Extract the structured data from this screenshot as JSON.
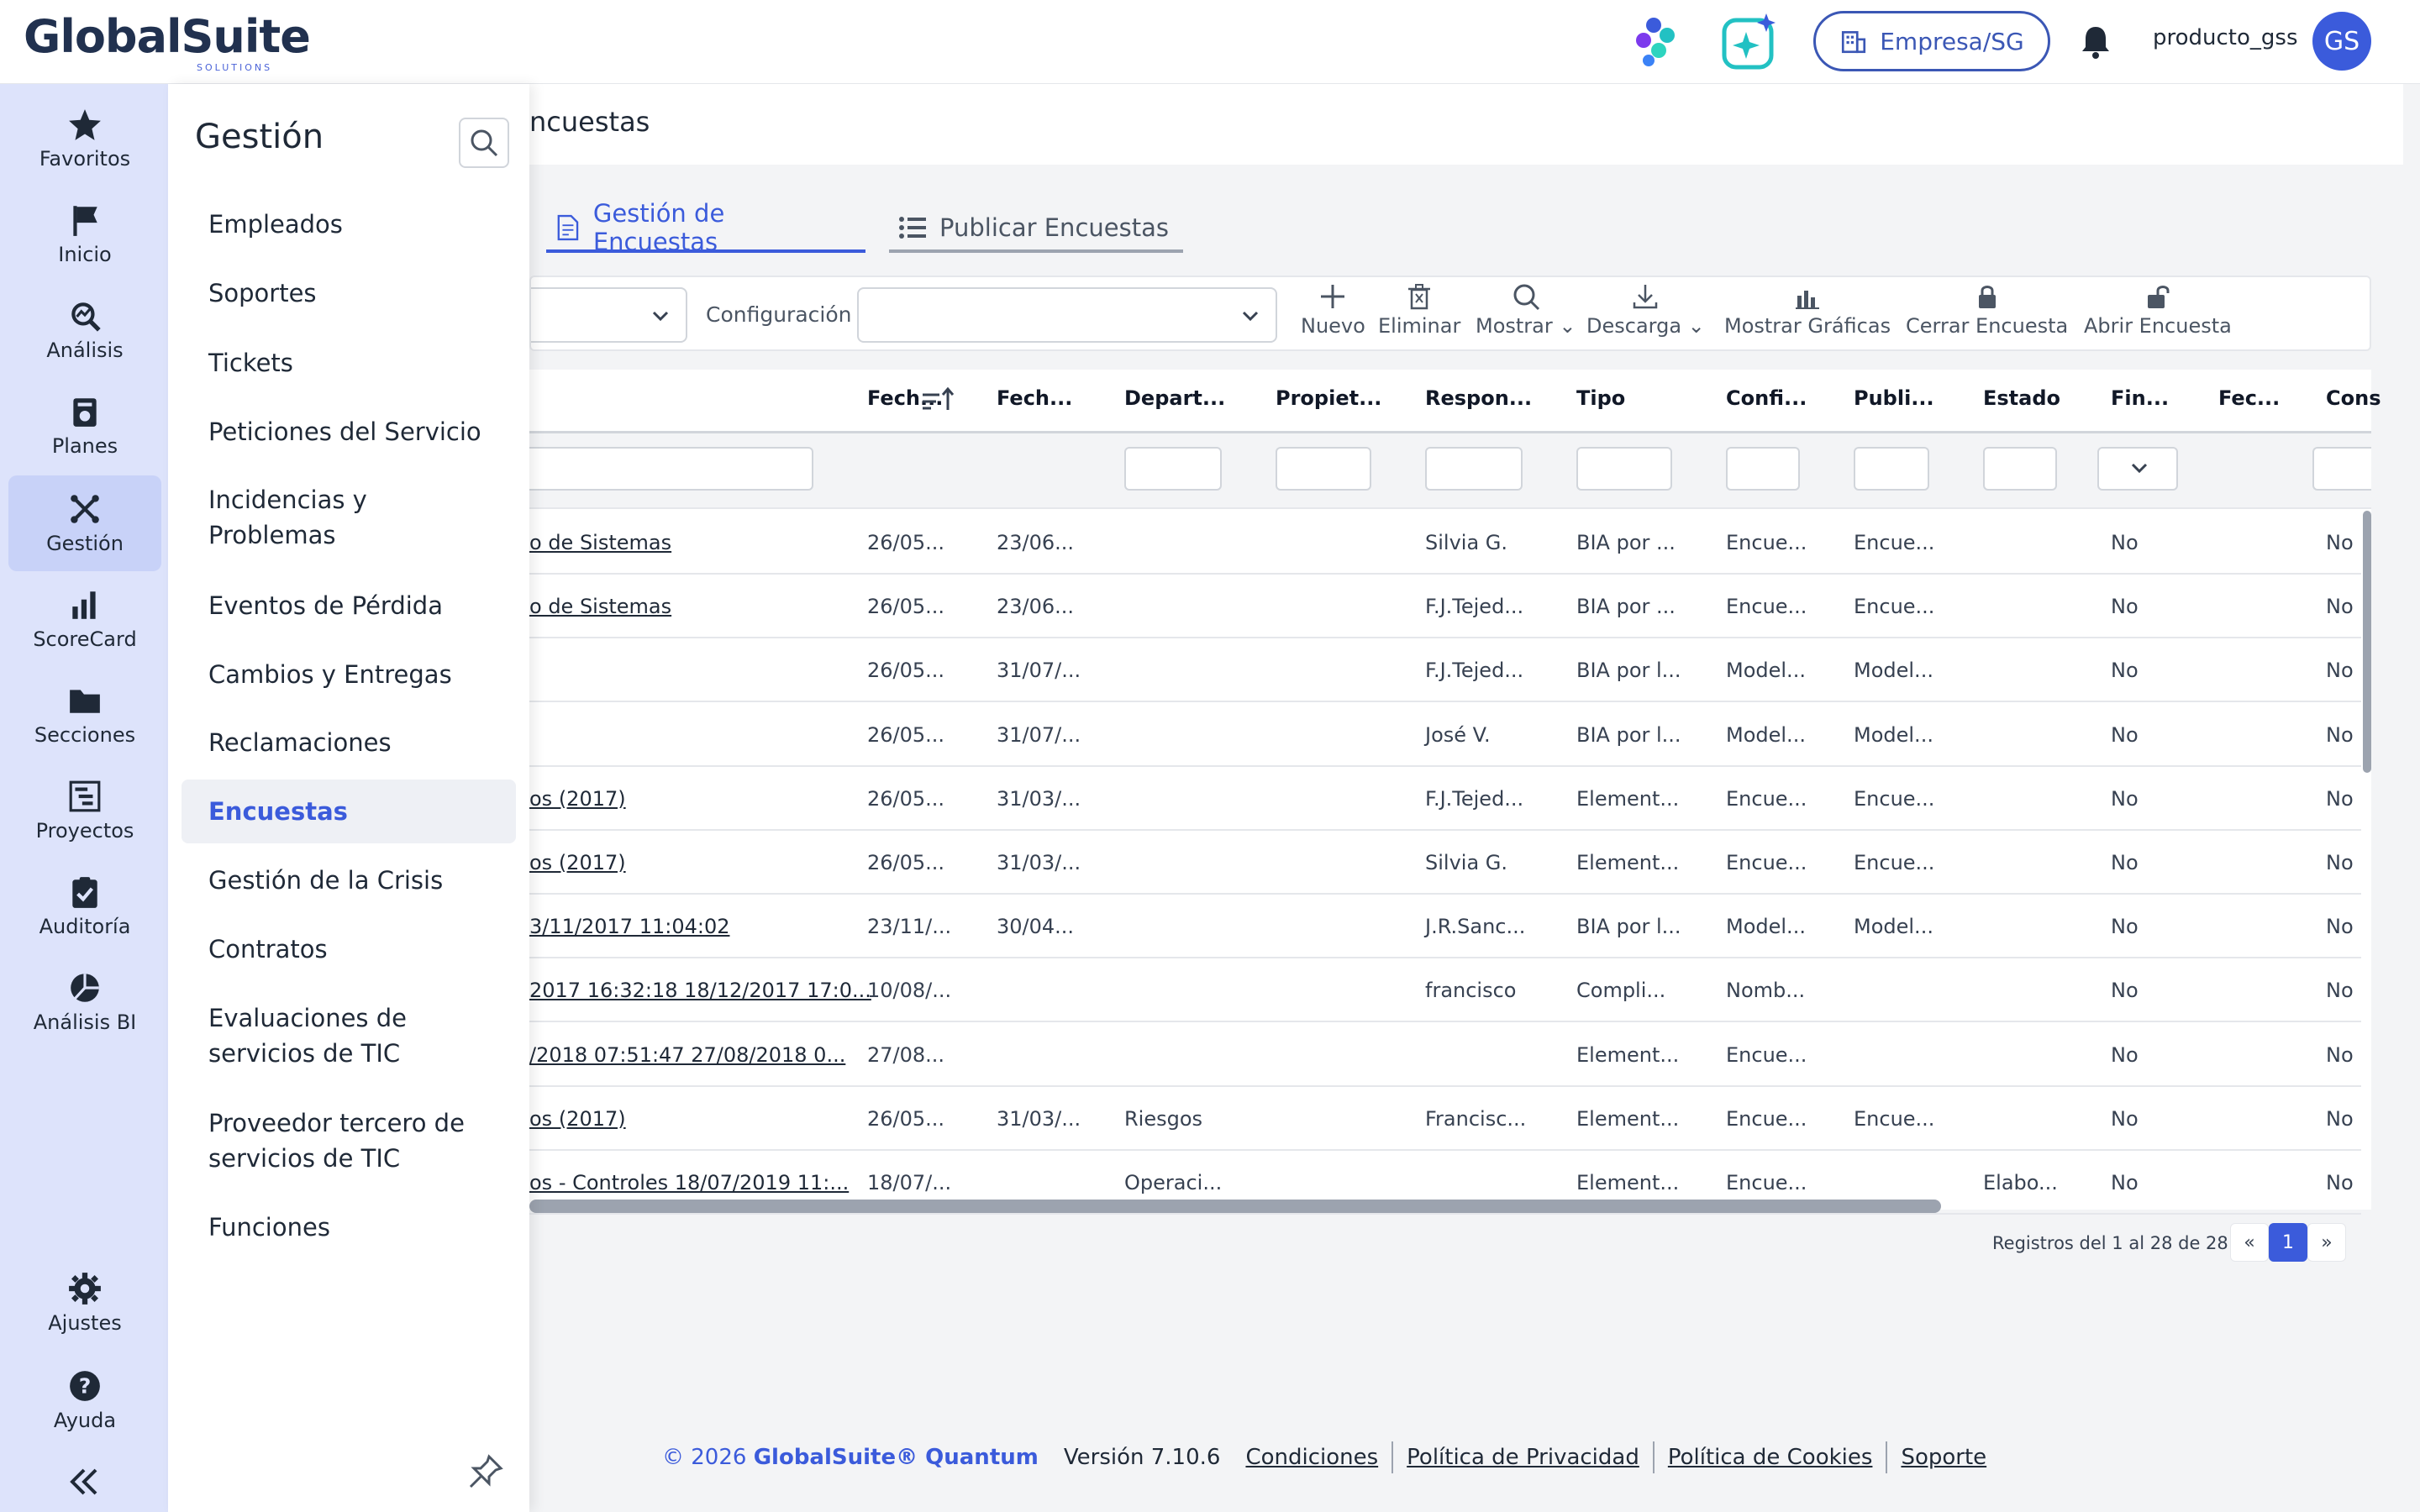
{
  "header": {
    "logo_text": "GlobalSuite",
    "logo_sub": "SOLUTIONS",
    "company_button": "Empresa/SG",
    "username": "producto_gss",
    "avatar_initials": "GS"
  },
  "nav": {
    "items": [
      {
        "label": "Favoritos",
        "icon": "star-icon"
      },
      {
        "label": "Inicio",
        "icon": "flag-icon"
      },
      {
        "label": "Análisis",
        "icon": "analysis-icon"
      },
      {
        "label": "Planes",
        "icon": "plans-icon"
      },
      {
        "label": "Gestión",
        "icon": "management-icon"
      },
      {
        "label": "ScoreCard",
        "icon": "bar-chart-icon"
      },
      {
        "label": "Secciones",
        "icon": "folder-icon"
      },
      {
        "label": "Proyectos",
        "icon": "projects-icon"
      },
      {
        "label": "Auditoría",
        "icon": "audit-icon"
      },
      {
        "label": "Análisis BI",
        "icon": "pie-chart-icon"
      }
    ],
    "settings": "Ajustes",
    "help": "Ayuda",
    "active": "Gestión"
  },
  "submenu": {
    "title": "Gestión",
    "items": [
      "Empleados",
      "Soportes",
      "Tickets",
      "Peticiones del Servicio",
      "Incidencias y Problemas",
      "Eventos de Pérdida",
      "Cambios y Entregas",
      "Reclamaciones",
      "Encuestas",
      "Gestión de la Crisis",
      "Contratos",
      "Evaluaciones de servicios de TIC",
      "Proveedor tercero de servicios de TIC",
      "Funciones"
    ],
    "active": "Encuestas"
  },
  "page": {
    "title": "ncuestas",
    "tabs": [
      "Gestión de Encuestas",
      "Publicar Encuestas"
    ],
    "config_label": "Configuración"
  },
  "toolbar": {
    "new": "Nuevo",
    "delete": "Eliminar",
    "show": "Mostrar",
    "download": "Descarga",
    "show_charts": "Mostrar Gráficas",
    "close_survey": "Cerrar Encuesta",
    "open_survey": "Abrir Encuesta"
  },
  "table": {
    "columns": [
      "Fech...",
      "Fech...",
      "Depart...",
      "Propiet...",
      "Respon...",
      "Tipo",
      "Confi...",
      "Publi...",
      "Estado",
      "Fin...",
      "Fec...",
      "Cons"
    ],
    "rows": [
      [
        "o de Sistemas",
        "26/05...",
        "23/06...",
        "",
        "",
        "Silvia G.",
        "BIA por ...",
        "Encue...",
        "Encue...",
        "",
        "No",
        "",
        "No"
      ],
      [
        "o de Sistemas",
        "26/05...",
        "23/06...",
        "",
        "",
        "F.J.Tejed...",
        "BIA por ...",
        "Encue...",
        "Encue...",
        "",
        "No",
        "",
        "No"
      ],
      [
        "",
        "26/05...",
        "31/07/...",
        "",
        "",
        "F.J.Tejed...",
        "BIA por l...",
        "Model...",
        "Model...",
        "",
        "No",
        "",
        "No"
      ],
      [
        "",
        "26/05...",
        "31/07/...",
        "",
        "",
        "José V.",
        "BIA por l...",
        "Model...",
        "Model...",
        "",
        "No",
        "",
        "No"
      ],
      [
        "os (2017)",
        "26/05...",
        "31/03/...",
        "",
        "",
        "F.J.Tejed...",
        "Element...",
        "Encue...",
        "Encue...",
        "",
        "No",
        "",
        "No"
      ],
      [
        "os (2017)",
        "26/05...",
        "31/03/...",
        "",
        "",
        "Silvia G.",
        "Element...",
        "Encue...",
        "Encue...",
        "",
        "No",
        "",
        "No"
      ],
      [
        "3/11/2017 11:04:02",
        "23/11/...",
        "30/04...",
        "",
        "",
        "J.R.Sanc...",
        "BIA por l...",
        "Model...",
        "Model...",
        "",
        "No",
        "",
        "No"
      ],
      [
        "2017 16:32:18 18/12/2017 17:0...",
        "10/08/...",
        "",
        "",
        "",
        "francisco",
        "Compli...",
        "Nomb...",
        "",
        "",
        "No",
        "",
        "No"
      ],
      [
        "/2018 07:51:47 27/08/2018 0...",
        "27/08...",
        "",
        "",
        "",
        "",
        "Element...",
        "Encue...",
        "",
        "",
        "No",
        "",
        "No"
      ],
      [
        "os (2017)",
        "26/05...",
        "31/03/...",
        "Riesgos",
        "",
        "Francisc...",
        "Element...",
        "Encue...",
        "Encue...",
        "",
        "No",
        "",
        "No"
      ],
      [
        "os - Controles 18/07/2019 11:...",
        "18/07/...",
        "",
        "Operaci...",
        "",
        "",
        "Element...",
        "Encue...",
        "",
        "Elabo...",
        "No",
        "",
        "No"
      ]
    ]
  },
  "pager": {
    "text": "Registros del 1 al 28 de 28",
    "prev": "«",
    "current": "1",
    "next": "»"
  },
  "footer": {
    "copyright_prefix": "© 2026 ",
    "brand": "GlobalSuite® Quantum",
    "version": "Versión 7.10.6",
    "links": [
      "Condiciones",
      "Política de Privacidad",
      "Política de Cookies",
      "Soporte"
    ]
  }
}
